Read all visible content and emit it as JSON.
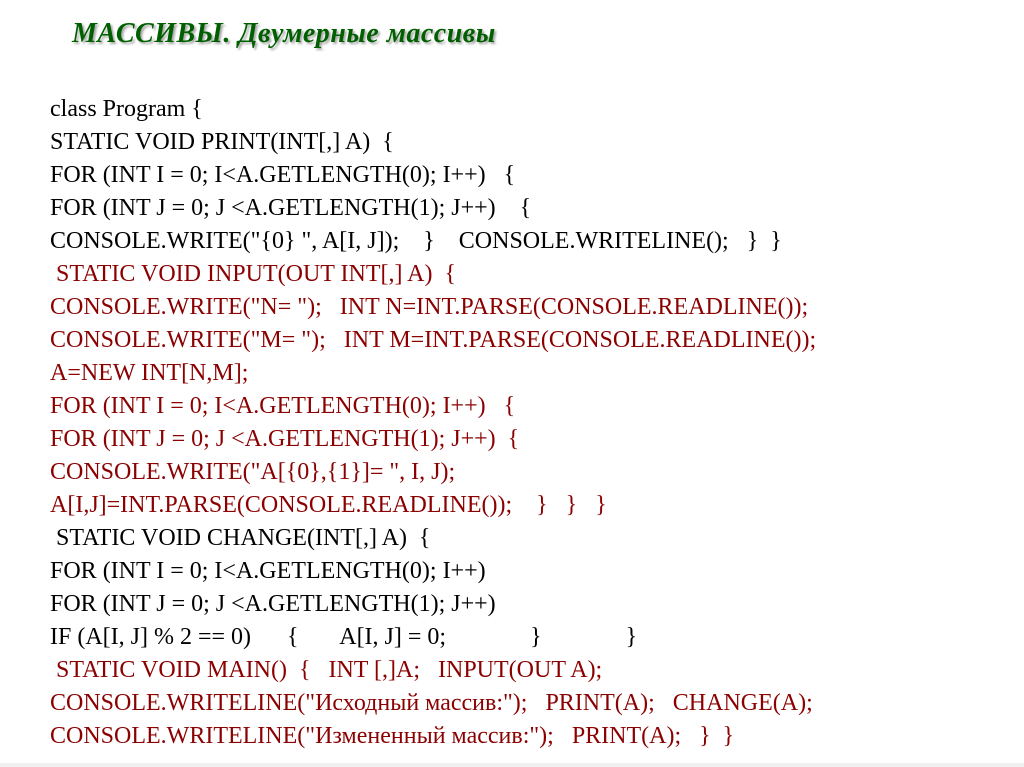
{
  "title": "МАССИВЫ.  Двумерные массивы",
  "code": {
    "l01": "class Program {",
    "l02": "STATIC VOID PRINT(INT[,] A)  {",
    "l03": "FOR (INT I = 0; I<A.GETLENGTH(0); I++)   {",
    "l04": "FOR (INT J = 0; J <A.GETLENGTH(1); J++)    {",
    "l05": "CONSOLE.WRITE(\"{0} \", A[I, J]);    }    CONSOLE.WRITELINE();   }  }",
    "l06": " STATIC VOID INPUT(OUT INT[,] A)  {",
    "l07": "CONSOLE.WRITE(\"N= \");   INT N=INT.PARSE(CONSOLE.READLINE());",
    "l08": "CONSOLE.WRITE(\"M= \");   INT M=INT.PARSE(CONSOLE.READLINE());",
    "l09": "A=NEW INT[N,M];",
    "l10": "FOR (INT I = 0; I<A.GETLENGTH(0); I++)   {",
    "l11": "FOR (INT J = 0; J <A.GETLENGTH(1); J++)  {",
    "l12": "CONSOLE.WRITE(\"A[{0},{1}]= \", I, J);",
    "l13": "A[I,J]=INT.PARSE(CONSOLE.READLINE());    }   }   }",
    "l14": " STATIC VOID CHANGE(INT[,] A)  {",
    "l15": "FOR (INT I = 0; I<A.GETLENGTH(0); I++)",
    "l16": "FOR (INT J = 0; J <A.GETLENGTH(1); J++)",
    "l17": "IF (A[I, J] % 2 == 0)      {       A[I, J] = 0;              }              }",
    "l18": " STATIC VOID MAIN()  {   INT [,]A;   INPUT(OUT A);",
    "l19": "CONSOLE.WRITELINE(\"Исходный массив:\");   PRINT(A);   CHANGE(A);",
    "l20": "CONSOLE.WRITELINE(\"Измененный массив:\");   PRINT(A);   }  }"
  }
}
